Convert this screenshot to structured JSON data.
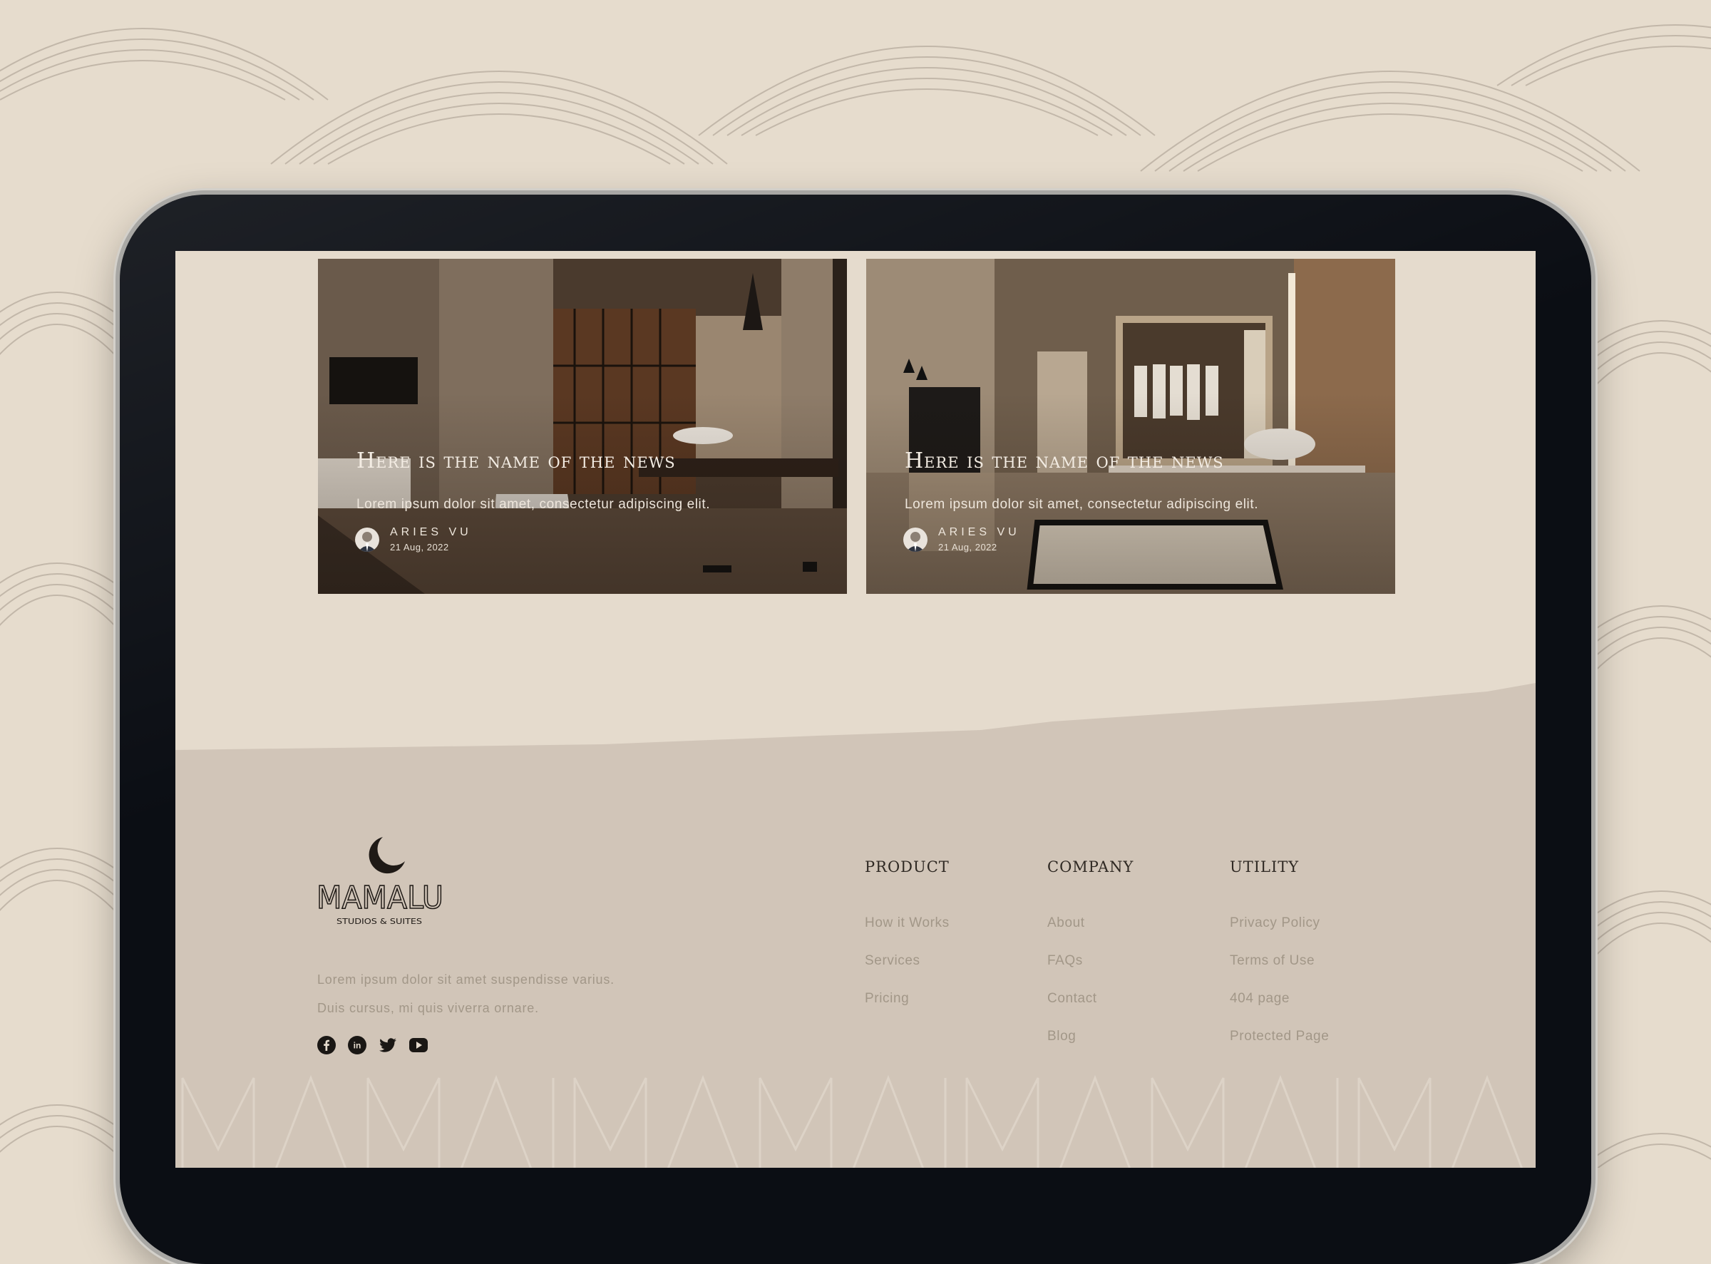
{
  "cards": [
    {
      "title": "Here is the name of the news",
      "excerpt": "Lorem ipsum dolor sit amet, consectetur adipiscing elit.",
      "author": "ARIES VU",
      "date": "21 Aug, 2022"
    },
    {
      "title": "Here is the name of the news",
      "excerpt": "Lorem ipsum dolor sit amet, consectetur adipiscing elit.",
      "author": "ARIES VU",
      "date": "21 Aug, 2022"
    }
  ],
  "footer": {
    "logo_word": "MAMALU",
    "logo_sub": "STUDIOS & SUITES",
    "about_line1": "Lorem ipsum dolor sit amet suspendisse varius.",
    "about_line2": "Duis cursus, mi quis viverra ornare.",
    "social_icons": [
      "facebook-icon",
      "linkedin-icon",
      "twitter-icon",
      "youtube-icon"
    ],
    "columns": [
      {
        "heading": "PRODUCT",
        "links": [
          "How it Works",
          "Services",
          "Pricing"
        ]
      },
      {
        "heading": "COMPANY",
        "links": [
          "About",
          "FAQs",
          "Contact",
          "Blog"
        ]
      },
      {
        "heading": "UTILITY",
        "links": [
          "Privacy Policy",
          "Terms of Use",
          "404 page",
          "Protected Page"
        ]
      }
    ]
  },
  "colors": {
    "page_bg": "#e6dccd",
    "screen_bg": "#e5dbcd",
    "footer_bg": "#d1c5b8",
    "text_muted": "#a29788",
    "heading": "#2f2923"
  }
}
